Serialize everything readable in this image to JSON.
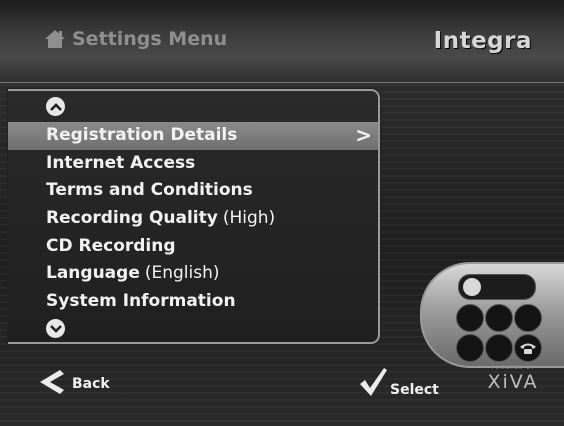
{
  "header": {
    "title": "Settings Menu",
    "brand": "Integra",
    "icon": "home-icon"
  },
  "menu": {
    "selected_index": 0,
    "items": [
      {
        "label": "Registration Details",
        "value": "",
        "has_submenu": true
      },
      {
        "label": "Internet Access",
        "value": ""
      },
      {
        "label": "Terms and Conditions",
        "value": ""
      },
      {
        "label": "Recording Quality",
        "value": "(High)"
      },
      {
        "label": "CD Recording",
        "value": ""
      },
      {
        "label": "Language",
        "value": "(English)"
      },
      {
        "label": "System Information",
        "value": ""
      }
    ],
    "scroll_up_icon": "chevron-up-icon",
    "scroll_down_icon": "chevron-down-icon",
    "submenu_indicator": ">"
  },
  "footer": {
    "back_label": "Back",
    "select_label": "Select",
    "powered_by": "POWERED BY",
    "powered_brand": "XiVA"
  },
  "colors": {
    "text": "#f2f2f2",
    "highlight": "#7c7c7c",
    "title_gray": "#8f8f8f"
  }
}
